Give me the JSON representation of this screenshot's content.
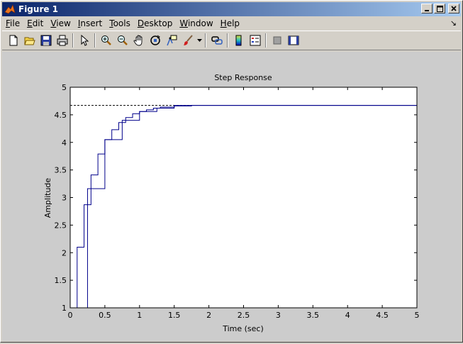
{
  "window": {
    "title": "Figure 1"
  },
  "menu": {
    "items": [
      {
        "label": "File",
        "accel": "F",
        "rest": "ile"
      },
      {
        "label": "Edit",
        "accel": "E",
        "rest": "dit"
      },
      {
        "label": "View",
        "accel": "V",
        "rest": "iew"
      },
      {
        "label": "Insert",
        "accel": "I",
        "rest": "nsert"
      },
      {
        "label": "Tools",
        "accel": "T",
        "rest": "ools"
      },
      {
        "label": "Desktop",
        "accel": "D",
        "rest": "esktop"
      },
      {
        "label": "Window",
        "accel": "W",
        "rest": "indow"
      },
      {
        "label": "Help",
        "accel": "H",
        "rest": "elp"
      }
    ]
  },
  "toolbar": {
    "icons": [
      "new-figure-icon",
      "open-file-icon",
      "save-icon",
      "print-icon",
      "pointer-icon",
      "zoom-in-icon",
      "zoom-out-icon",
      "pan-hand-icon",
      "rotate-3d-icon",
      "data-cursor-icon",
      "brush-icon",
      "link-icon",
      "colorbar-icon",
      "legend-icon",
      "hide-plot-tools-icon",
      "show-plot-tools-icon"
    ]
  },
  "chart_data": {
    "type": "line",
    "title": "Step Response",
    "xlabel": "Time (sec)",
    "ylabel": "Amplitude",
    "xlim": [
      0,
      5
    ],
    "ylim": [
      1,
      5
    ],
    "xticks": [
      "0",
      "0.5",
      "1",
      "1.5",
      "2",
      "2.5",
      "3",
      "3.5",
      "4",
      "4.5",
      "5"
    ],
    "yticks": [
      "1",
      "1.5",
      "2",
      "2.5",
      "3",
      "3.5",
      "4",
      "4.5",
      "5"
    ],
    "steady_state": 4.67,
    "line_color": "#00008b",
    "series": [
      {
        "x": [
          0,
          0.1,
          0.1,
          0.2,
          0.2,
          0.3,
          0.3,
          0.4,
          0.4,
          0.5,
          0.5,
          0.6,
          0.6,
          0.7,
          0.7,
          0.8,
          0.8,
          0.9,
          0.9,
          1.0,
          1.0,
          1.1,
          1.1,
          1.2,
          1.2,
          1.3,
          1.3,
          1.5,
          1.5,
          1.75,
          1.75,
          5
        ],
        "y": [
          1,
          1,
          2.1,
          2.1,
          2.87,
          2.87,
          3.41,
          3.41,
          3.79,
          3.79,
          4.05,
          4.05,
          4.23,
          4.23,
          4.36,
          4.36,
          4.45,
          4.45,
          4.52,
          4.52,
          4.56,
          4.56,
          4.59,
          4.59,
          4.62,
          4.62,
          4.64,
          4.64,
          4.66,
          4.66,
          4.67,
          4.67
        ]
      },
      {
        "x": [
          0,
          0.25,
          0.25,
          0.3,
          0.3,
          0.5,
          0.5,
          0.75,
          0.75,
          1.0,
          1.0,
          1.25,
          1.25,
          1.5,
          1.5,
          5
        ],
        "y": [
          1,
          1,
          3.16,
          3.16,
          3.16,
          3.16,
          4.05,
          4.05,
          4.4,
          4.4,
          4.56,
          4.56,
          4.62,
          4.62,
          4.67,
          4.67
        ]
      }
    ]
  }
}
